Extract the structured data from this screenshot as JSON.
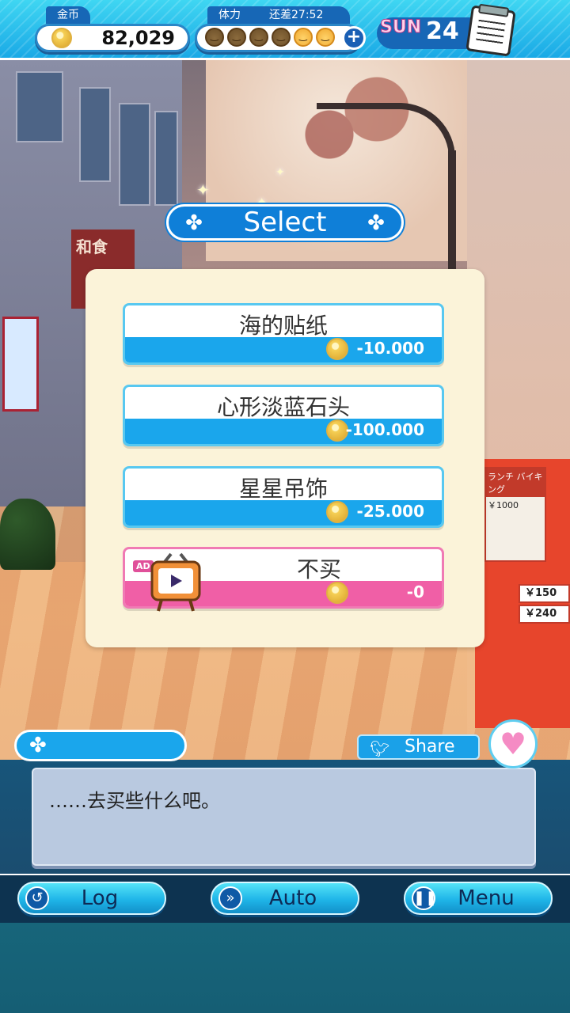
{
  "hud": {
    "gold": {
      "label": "金币",
      "value": "82,029",
      "icon": "coin-icon"
    },
    "stamina": {
      "label": "体力",
      "timer": "还差27:52",
      "filled": 4,
      "max": 6,
      "plus_icon": "plus-icon"
    },
    "day": {
      "weekday": "SUN",
      "number": "24",
      "icon": "notepad-icon"
    }
  },
  "select": {
    "title": "Select",
    "options": [
      {
        "label": "海的贴纸",
        "price": "-10.000",
        "style": "blue"
      },
      {
        "label": "心形淡蓝石头",
        "price": "-100.000",
        "style": "blue"
      },
      {
        "label": "星星吊饰",
        "price": "-25.000",
        "style": "blue"
      },
      {
        "label": "不买",
        "price": "-0",
        "style": "pink",
        "badge": "AD"
      }
    ]
  },
  "dialogue": {
    "speaker": "",
    "text": "……去买些什么吧。",
    "share_label": "Share"
  },
  "controls": [
    {
      "label": "Log",
      "icon": "log-icon"
    },
    {
      "label": "Auto",
      "icon": "auto-icon"
    },
    {
      "label": "Menu",
      "icon": "pause-icon"
    }
  ],
  "scene_text": {
    "sign_left": "和食",
    "menu_title": "ランチ バイキング",
    "menu_price": "￥1000",
    "price_1": "￥150",
    "price_2": "￥240"
  },
  "colors": {
    "accent": "#1aa6ec",
    "pink": "#f05fa6",
    "panel": "#fbf3d9"
  }
}
